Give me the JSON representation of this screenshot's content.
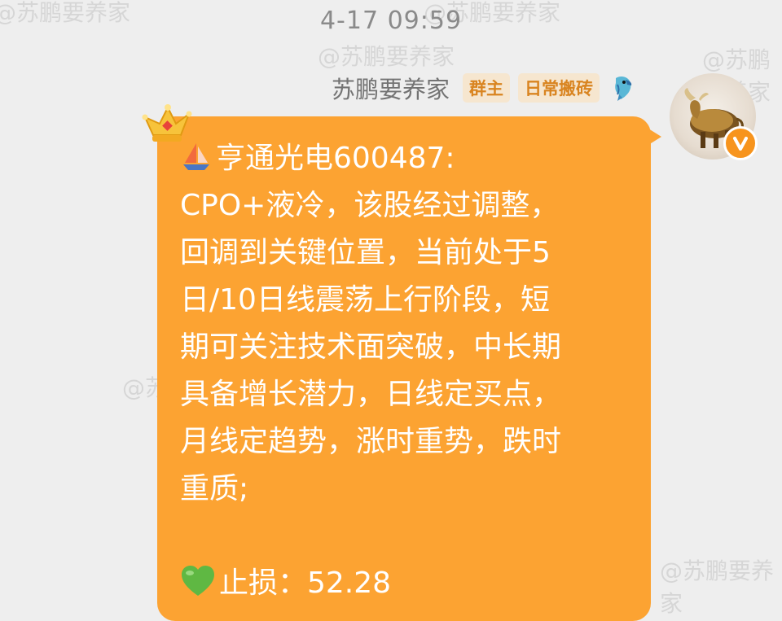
{
  "timestamp": "4-17 09:59",
  "sender": {
    "name": "苏鹏要养家",
    "badges": [
      "群主",
      "日常搬砖"
    ],
    "avatar_icon": "bull-avatar",
    "verified_icon": "verified-v-icon"
  },
  "message": {
    "lines": [
      "亨通光电600487:",
      "CPO+液冷，该股经过调整，",
      "回调到关键位置，当前处于5",
      "日/10日线震荡上行阶段，短",
      "期可关注技术面突破，中长期",
      "具备增长潜力，日线定买点，",
      "月线定趋势，涨时重势，跌时",
      "重质;"
    ],
    "stop_loss": "止损：52.28"
  },
  "watermark_text": "@苏鹏要养家",
  "colors": {
    "bubble": "#fca332",
    "badge_bg": "#f6e6cf",
    "badge_text": "#d98420",
    "background": "#eeeeee"
  }
}
